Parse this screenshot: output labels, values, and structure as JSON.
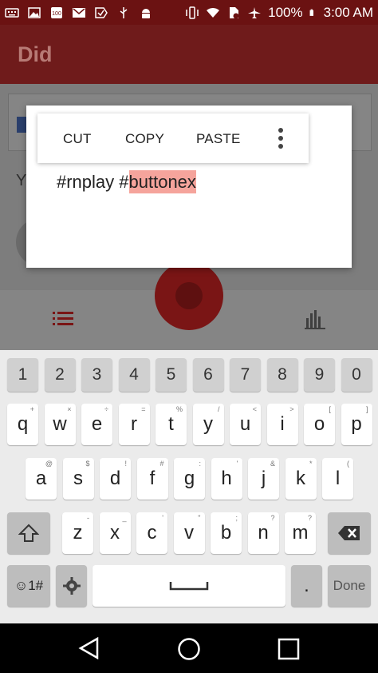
{
  "status_bar": {
    "battery": "100%",
    "time": "3:00 AM",
    "icons": [
      "keyboard-icon",
      "image-icon",
      "100-icon",
      "mail-icon",
      "check-icon",
      "usb-icon",
      "android-icon",
      "vibrate-icon",
      "wifi-icon",
      "no-sim-icon",
      "airplane-icon",
      "battery-icon"
    ]
  },
  "app": {
    "title": "Did",
    "body_letter": "Y"
  },
  "context_menu": {
    "cut": "CUT",
    "copy": "COPY",
    "paste": "PASTE",
    "more": "more-vert-icon"
  },
  "text_field": {
    "prefix": "#rnplay #",
    "selected": "buttonex"
  },
  "keyboard": {
    "number_row": [
      "1",
      "2",
      "3",
      "4",
      "5",
      "6",
      "7",
      "8",
      "9",
      "0"
    ],
    "row1": [
      {
        "k": "q",
        "s": "+"
      },
      {
        "k": "w",
        "s": "×"
      },
      {
        "k": "e",
        "s": "÷"
      },
      {
        "k": "r",
        "s": "="
      },
      {
        "k": "t",
        "s": "%"
      },
      {
        "k": "y",
        "s": "/"
      },
      {
        "k": "u",
        "s": "<"
      },
      {
        "k": "i",
        "s": ">"
      },
      {
        "k": "o",
        "s": "["
      },
      {
        "k": "p",
        "s": "]"
      }
    ],
    "row2": [
      {
        "k": "a",
        "s": "@"
      },
      {
        "k": "s",
        "s": "$"
      },
      {
        "k": "d",
        "s": "!"
      },
      {
        "k": "f",
        "s": "#"
      },
      {
        "k": "g",
        "s": ":"
      },
      {
        "k": "h",
        "s": "'"
      },
      {
        "k": "j",
        "s": "&"
      },
      {
        "k": "k",
        "s": "*"
      },
      {
        "k": "l",
        "s": "("
      }
    ],
    "row3": [
      {
        "k": "z",
        "s": "-"
      },
      {
        "k": "x",
        "s": "_"
      },
      {
        "k": "c",
        "s": "'"
      },
      {
        "k": "v",
        "s": "\""
      },
      {
        "k": "b",
        "s": ";"
      },
      {
        "k": "n",
        "s": "?"
      },
      {
        "k": "m",
        "s": "?"
      }
    ],
    "emoji_label": "☺1#",
    "period": ".",
    "done": "Done"
  }
}
